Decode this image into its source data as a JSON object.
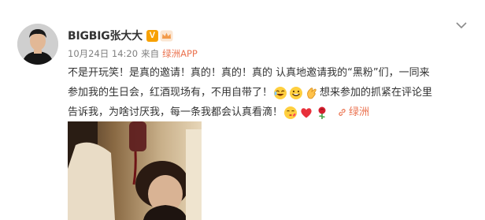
{
  "post": {
    "username": "BIGBIG张大大",
    "verified_badge": "V",
    "timestamp": "10月24日 14:20",
    "source_prefix": "来自",
    "source_app": "绿洲APP",
    "lines": [
      "不是开玩笑！是真的邀请！真的！真的！真的 认真地邀请我的“黑粉”们，一同来",
      "参加我的生日会，红酒现场有，不用自带了！",
      "想来参加的抓紧在评论里",
      "告诉我，为啥讨厌我，每一条我都会认真看滴！"
    ],
    "link_label": "绿洲",
    "icons": {
      "expand": "chevron-down-icon",
      "badge": "verified-icon",
      "crown": "crown-icon",
      "emoji1": "laugh-cry-emoji",
      "emoji2": "grin-emoji",
      "emoji3": "clap-emoji",
      "emoji4": "kiss-emoji",
      "heart": "heart-icon",
      "rose": "rose-icon",
      "link": "link-icon"
    },
    "colors": {
      "accent": "#eb7350",
      "badge": "#f7a100",
      "text": "#333333",
      "meta": "#808080"
    }
  }
}
